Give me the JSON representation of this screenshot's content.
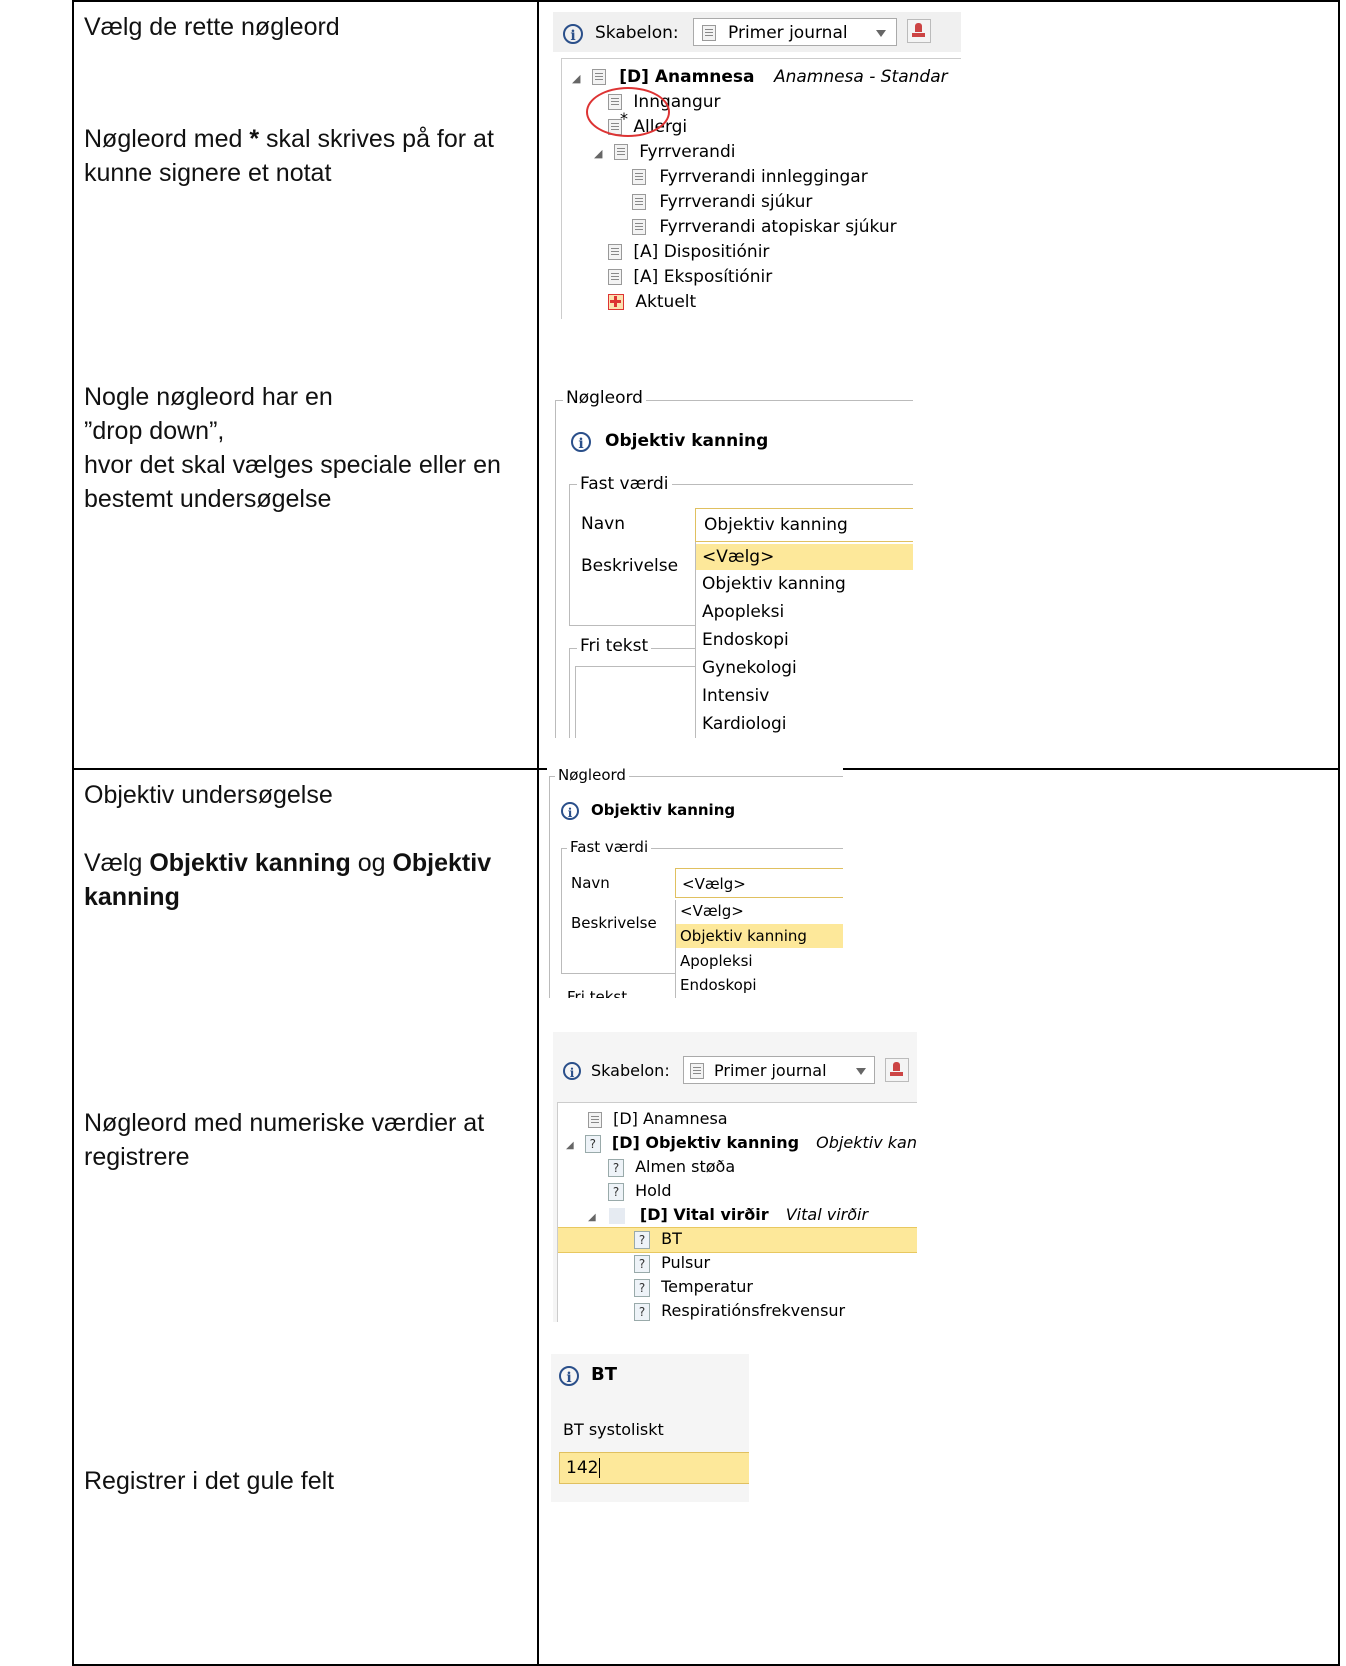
{
  "left": {
    "row1": {
      "t1": "Vælg de rette nøgleord",
      "t2a": "Nøgleord med ",
      "t2star": "*",
      "t2b": " skal skrives på for at",
      "t2c": "kunne signere et notat",
      "t3a": "Nogle nøgleord har en",
      "t3b": "”drop down”,",
      "t3c": "hvor det skal vælges speciale eller en",
      "t3d": "bestemt undersøgelse"
    },
    "row2": {
      "t1": "Objektiv undersøgelse",
      "t2a": "Vælg ",
      "t2b": "Objektiv kanning",
      "t2c": " og ",
      "t2d": "Objektiv",
      "t2e": "kanning",
      "t3a": "Nøgleord med numeriske værdier at",
      "t3b": "registrere",
      "t4": "Registrer i det gule felt"
    }
  },
  "shot1": {
    "skabelon_label": "Skabelon:",
    "skabelon_value": "Primer journal",
    "tree": [
      {
        "label": "[D] Anamnesa",
        "desc": "Anamnesa - Standar"
      },
      {
        "label": "Inngangur"
      },
      {
        "label": "Allergi",
        "mark": "*"
      },
      {
        "label": "Fyrrverandi"
      },
      {
        "label": "Fyrrverandi innleggingar"
      },
      {
        "label": "Fyrrverandi sjúkur"
      },
      {
        "label": "Fyrrverandi atopiskar sjúkur"
      },
      {
        "label": "[A] Dispositiónir"
      },
      {
        "label": "[A] Eksposítiónir"
      },
      {
        "label": "Aktuelt"
      }
    ]
  },
  "shot2": {
    "noegleord": "Nøgleord",
    "title": "Objektiv kanning",
    "fast_vaerdi": "Fast værdi",
    "navn_label": "Navn",
    "navn_value": "Objektiv kanning",
    "beskrivelse_label": "Beskrivelse",
    "fri_tekst": "Fri tekst",
    "options": [
      "<Vælg>",
      "Objektiv kanning",
      "Apopleksi",
      "Endoskopi",
      "Gynekologi",
      "Intensiv",
      "Kardiologi"
    ]
  },
  "shot3": {
    "noegleord": "Nøgleord",
    "title": "Objektiv kanning",
    "fast_vaerdi": "Fast værdi",
    "navn_label": "Navn",
    "navn_value": "<Vælg>",
    "beskrivelse_label": "Beskrivelse",
    "fri_tekst": "Fri tekst",
    "options": [
      "<Vælg>",
      "Objektiv kanning",
      "Apopleksi",
      "Endoskopi"
    ]
  },
  "shot4": {
    "skabelon_label": "Skabelon:",
    "skabelon_value": "Primer journal",
    "tree": [
      {
        "label": "[D] Anamnesa"
      },
      {
        "label": "[D] Objektiv kanning",
        "desc": "Objektiv kanni"
      },
      {
        "label": "Almen støða"
      },
      {
        "label": "Hold"
      },
      {
        "label": "[D] Vital virðir",
        "desc": "Vital virðir"
      },
      {
        "label": "BT"
      },
      {
        "label": "Pulsur"
      },
      {
        "label": "Temperatur"
      },
      {
        "label": "Respiratiónsfrekvensur"
      }
    ]
  },
  "shot5": {
    "title": "BT",
    "field_label": "BT systoliskt",
    "field_value": "142"
  }
}
